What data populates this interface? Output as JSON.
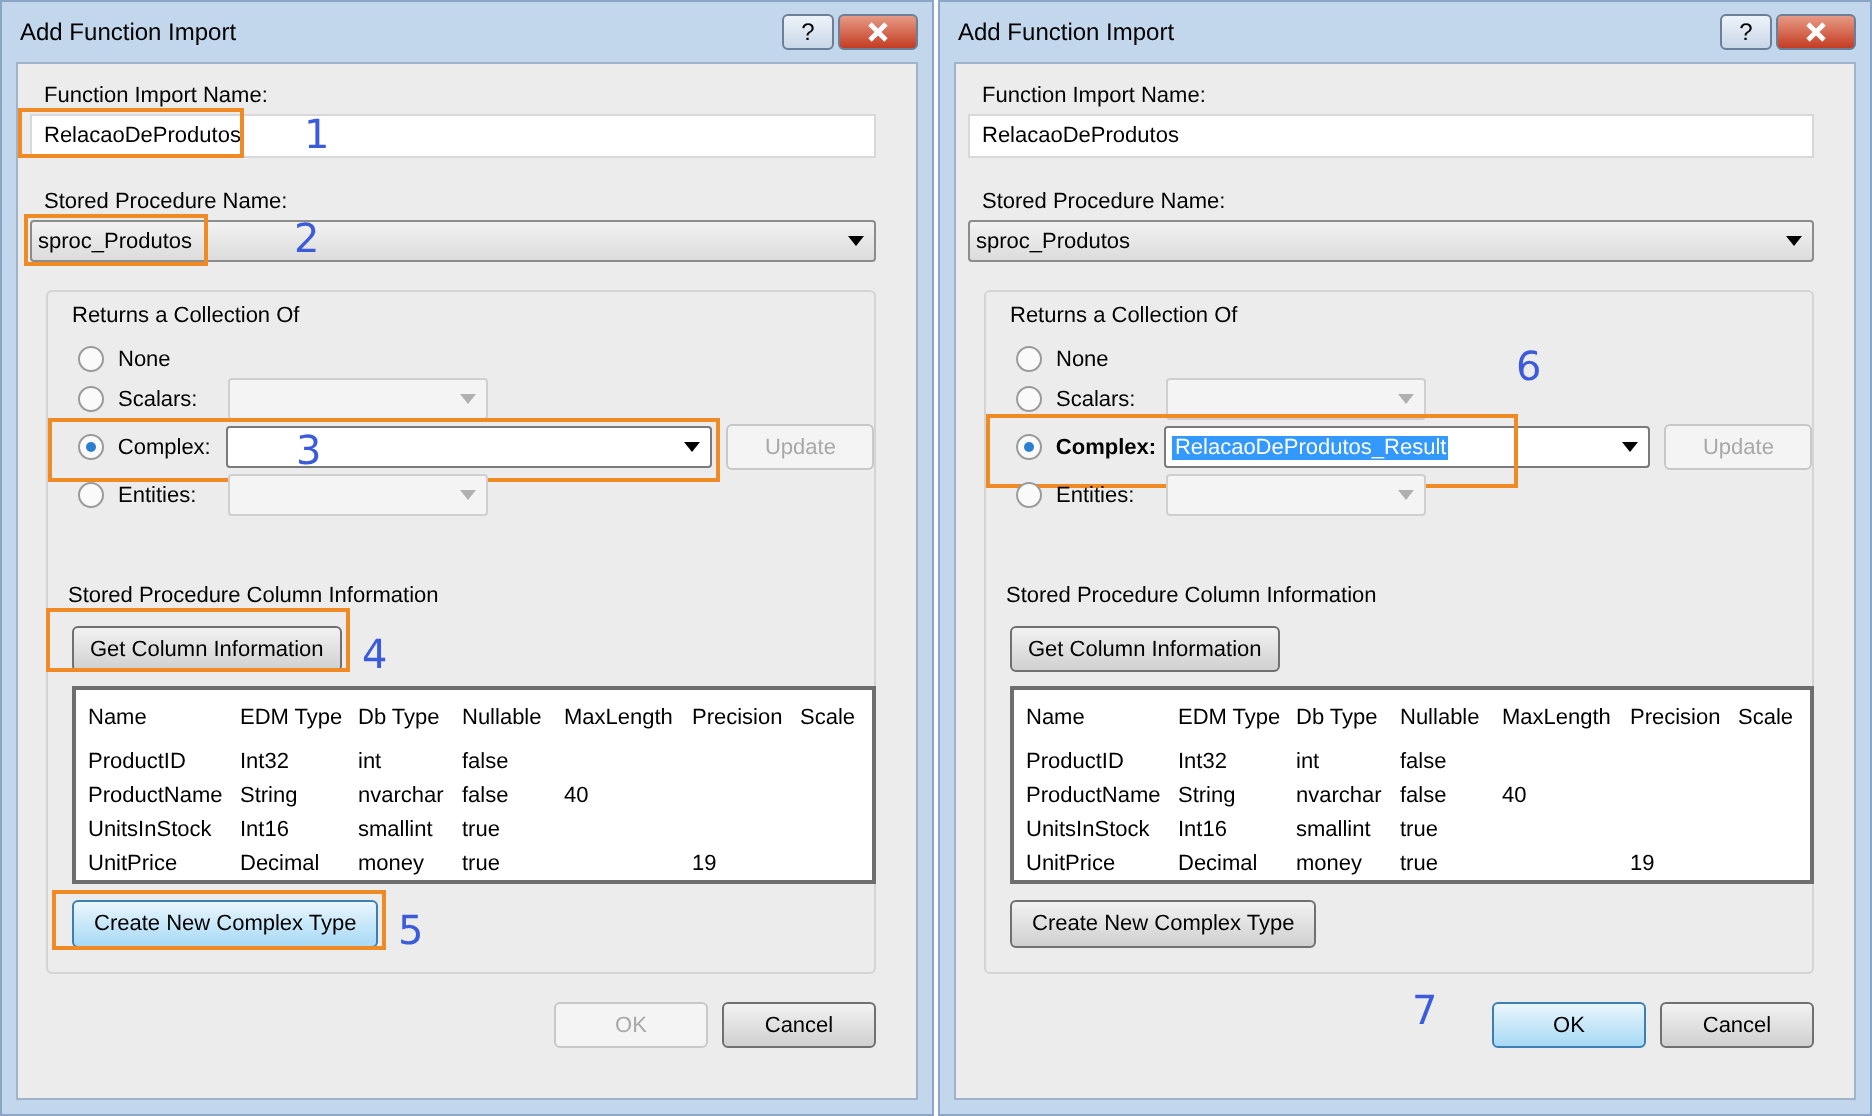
{
  "dialogs": [
    {
      "title": "Add Function Import",
      "help_button": "?",
      "name_label": "Function Import Name:",
      "name_value": "RelacaoDeProdutos",
      "name_callout": "1",
      "procedure_label": "Stored Procedure Name:",
      "procedure_value": "sproc_Produtos",
      "procedure_callout": "2",
      "returns_label": "Returns a Collection Of",
      "options": [
        {
          "kind": "plain",
          "label": "None",
          "selected": false,
          "bold": false
        },
        {
          "kind": "combo",
          "label": "Scalars:",
          "selected": false,
          "bold": false,
          "combo": {
            "disabled": true
          }
        },
        {
          "kind": "combo",
          "label": "Complex:",
          "selected": true,
          "bold": false,
          "combo": {
            "disabled": false
          },
          "update_button": {
            "label": "Update",
            "disabled": true
          },
          "callout": {
            "number": "3",
            "kind": "inside"
          }
        },
        {
          "kind": "combo",
          "label": "Entities:",
          "selected": false,
          "bold": false,
          "combo": {
            "disabled": true
          }
        }
      ],
      "column_info_label": "Stored Procedure Column Information",
      "get_button": "Get Column Information",
      "get_callout": "4",
      "table": {
        "columns": [
          "Name",
          "EDM Type",
          "Db Type",
          "Nullable",
          "MaxLength",
          "Precision",
          "Scale"
        ],
        "rows": [
          [
            "ProductID",
            "Int32",
            "int",
            "false",
            "",
            "",
            ""
          ],
          [
            "ProductName",
            "String",
            "nvarchar",
            "false",
            "40",
            "",
            ""
          ],
          [
            "UnitsInStock",
            "Int16",
            "smallint",
            "true",
            "",
            "",
            ""
          ],
          [
            "UnitPrice",
            "Decimal",
            "money",
            "true",
            "",
            "19",
            ""
          ]
        ]
      },
      "create_button": {
        "label": "Create New Complex Type",
        "focused": true
      },
      "create_callout": "5",
      "ok_button": {
        "label": "OK",
        "disabled": true,
        "focused": false
      },
      "cancel_button": "Cancel"
    },
    {
      "title": "Add Function Import",
      "help_button": "?",
      "name_label": "Function Import Name:",
      "name_value": "RelacaoDeProdutos",
      "procedure_label": "Stored Procedure Name:",
      "procedure_value": "sproc_Produtos",
      "returns_label": "Returns a Collection Of",
      "options": [
        {
          "kind": "plain",
          "label": "None",
          "selected": false,
          "bold": false
        },
        {
          "kind": "combo",
          "label": "Scalars:",
          "selected": false,
          "bold": false,
          "combo": {
            "disabled": true
          }
        },
        {
          "kind": "combo",
          "label": "Complex:",
          "selected": true,
          "bold": true,
          "combo": {
            "disabled": false,
            "value": "RelacaoDeProdutos_Result",
            "highlighted": true
          },
          "update_button": {
            "label": "Update",
            "disabled": true
          },
          "callout": {
            "number": "6",
            "kind": "above"
          }
        },
        {
          "kind": "combo",
          "label": "Entities:",
          "selected": false,
          "bold": false,
          "combo": {
            "disabled": true
          }
        }
      ],
      "column_info_label": "Stored Procedure Column Information",
      "get_button": "Get Column Information",
      "table": {
        "columns": [
          "Name",
          "EDM Type",
          "Db Type",
          "Nullable",
          "MaxLength",
          "Precision",
          "Scale"
        ],
        "rows": [
          [
            "ProductID",
            "Int32",
            "int",
            "false",
            "",
            "",
            ""
          ],
          [
            "ProductName",
            "String",
            "nvarchar",
            "false",
            "40",
            "",
            ""
          ],
          [
            "UnitsInStock",
            "Int16",
            "smallint",
            "true",
            "",
            "",
            ""
          ],
          [
            "UnitPrice",
            "Decimal",
            "money",
            "true",
            "",
            "19",
            ""
          ]
        ]
      },
      "create_button": {
        "label": "Create New Complex Type",
        "focused": false
      },
      "ok_button": {
        "label": "OK",
        "disabled": false,
        "focused": true
      },
      "ok_callout": "7",
      "cancel_button": "Cancel"
    }
  ]
}
